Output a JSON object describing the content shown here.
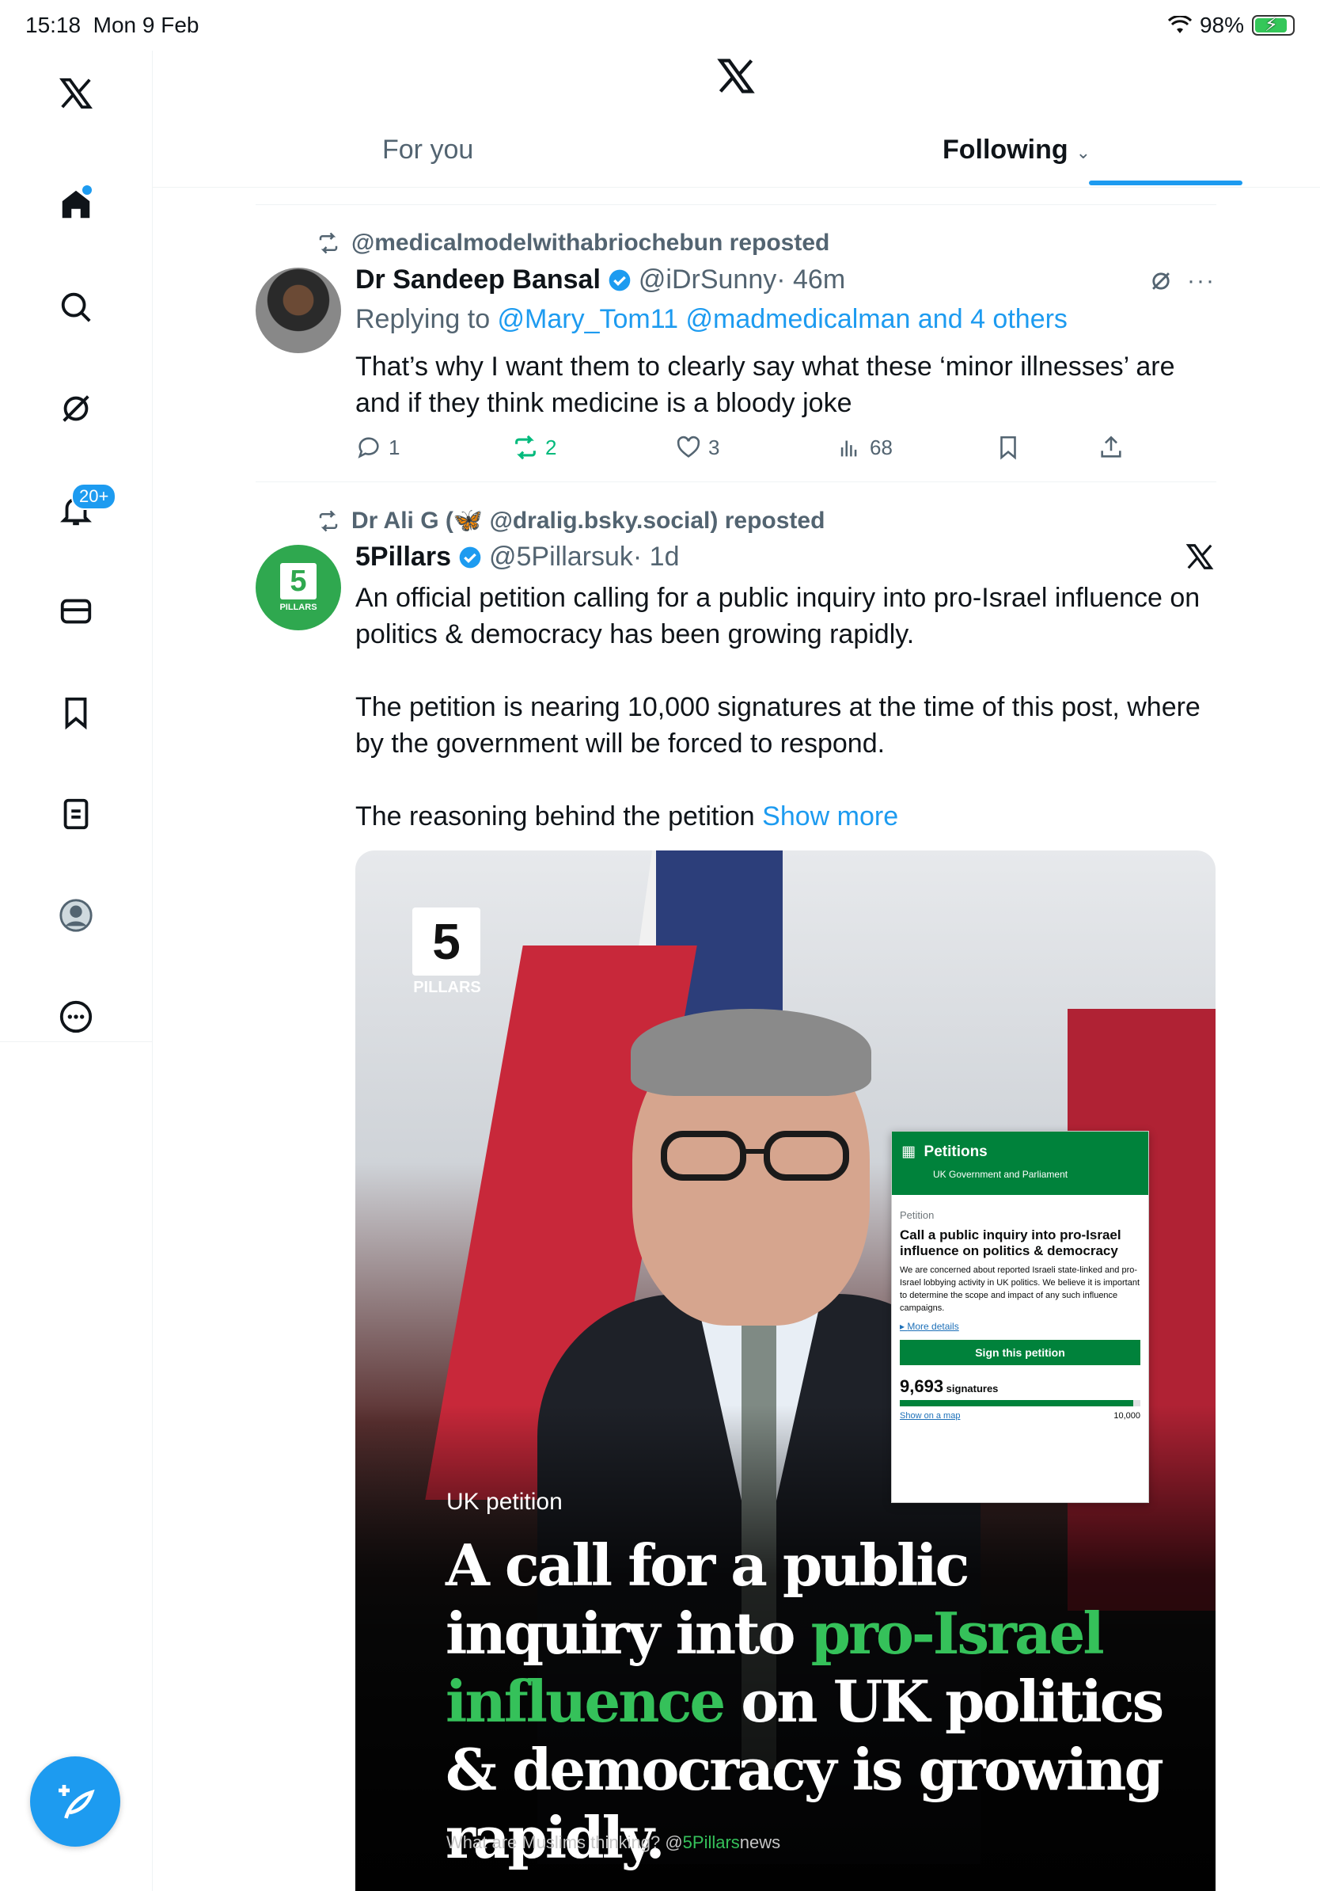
{
  "status_bar": {
    "time": "15:18",
    "date": "Mon 9 Feb",
    "battery": "98%"
  },
  "sidebar": {
    "notifications_badge": "20+"
  },
  "tabs": {
    "for_you": "For you",
    "following": "Following",
    "following_chevron": "⌄"
  },
  "tweets": [
    {
      "reposted_by": "@medicalmodelwithabriochebun reposted",
      "name": "Dr Sandeep Bansal",
      "handle": "@iDrSunny",
      "time": "· 46m",
      "reply_prefix": "Replying to ",
      "reply_to": "@Mary_Tom11 @madmedicalman and 4 others",
      "text": "That’s why I want them to clearly say what these ‘minor illnesses’ are and if they think medicine is a bloody joke",
      "replies": "1",
      "reposts": "2",
      "likes": "3",
      "views": "68"
    },
    {
      "reposted_by": "Dr Ali G (🦋 @dralig.bsky.social) reposted",
      "name": "5Pillars",
      "handle": "@5Pillarsuk",
      "time": "· 1d",
      "avatar_number": "5",
      "avatar_text": "PILLARS",
      "text_p1": "An official petition calling for a public inquiry into pro-Israel influence on politics & democracy has been growing rapidly.",
      "text_p2": "The petition is nearing 10,000 signatures at the time of this post, where by the government will be forced to respond.",
      "text_p3": "The reasoning behind the petition ",
      "show_more": "Show more"
    }
  ],
  "media": {
    "logo_number": "5",
    "logo_text": "PILLARS",
    "kicker": "UK petition",
    "headline_1": "A call for a public inquiry into ",
    "headline_green": "pro-Israel influence",
    "headline_2": " on UK politics & democracy is growing rapidly.",
    "footer": "What are Muslims thinking? @",
    "footer_brand": "5Pillars",
    "footer_end": "news",
    "petition": {
      "title": "Petitions",
      "subtitle": "UK Government and Parliament",
      "label": "Petition",
      "heading": "Call a public inquiry into pro-Israel influence on politics & democracy",
      "description": "We are concerned about reported Israeli state-linked and pro-Israel lobbying activity in UK politics. We believe it is important to determine the scope and impact of any such influence campaigns.",
      "more_details": "More details",
      "sign_button": "Sign this petition",
      "signatures": "9,693",
      "signatures_label": " signatures",
      "signature_progress": 0.9693,
      "show_on_map": "Show on a map",
      "target": "10,000"
    }
  },
  "colors": {
    "accent": "#1d9bf0",
    "repost_green": "#00ba7c",
    "petition_green": "#00823b"
  }
}
